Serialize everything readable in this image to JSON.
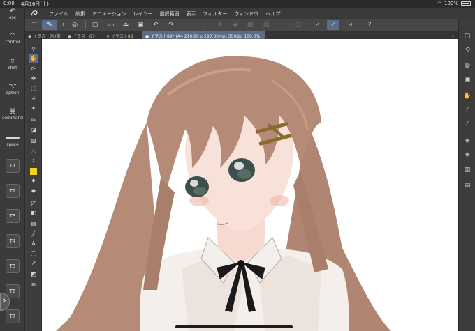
{
  "status": {
    "time": "0:00",
    "date": "4月16日(土)",
    "battery": "100%"
  },
  "modifiers": [
    {
      "glyph": "↶",
      "label": "esc"
    },
    {
      "glyph": "^",
      "label": "control"
    },
    {
      "glyph": "⇧",
      "label": "shift"
    },
    {
      "glyph": "⌥",
      "label": "option"
    },
    {
      "glyph": "⌘",
      "label": "command"
    },
    {
      "glyph": "",
      "label": "space"
    }
  ],
  "tkeys": [
    "T1",
    "T2",
    "T3",
    "T4",
    "T5",
    "T6",
    "T7"
  ],
  "menu": [
    "ファイル",
    "編集",
    "アニメーション",
    "レイヤー",
    "選択範囲",
    "表示",
    "フィルター",
    "ウィンドウ",
    "ヘルプ"
  ],
  "tabs": [
    {
      "label": "● イラスト79(変",
      "active": false
    },
    {
      "label": "● イラスト87*",
      "active": false
    },
    {
      "label": "✕ イラスト88",
      "active": false
    },
    {
      "label": "● イラスト89* (A4 210.00 x 297.00mm 350dpi 100.0%)",
      "active": true
    }
  ],
  "toolbar_icons": [
    "menu-icon",
    "brush-preset-icon",
    "stepper-icon",
    "color-icon",
    "new-icon",
    "open-icon",
    "save-icon",
    "export-icon",
    "undo-icon",
    "redo-icon",
    "clear-icon",
    "transform-icon",
    "select-icon",
    "fill-icon",
    "grid-icon",
    "ruler-icon",
    "pen-check-icon",
    "pen-active-icon",
    "pen-alt-icon",
    "help-icon"
  ],
  "colors": {
    "accent": "#5c6c84",
    "yellow_tool": "#f1d21c",
    "hair": "#b58b77",
    "eyes": "#3d4f4a",
    "ribbon": "#1a1a1a"
  }
}
